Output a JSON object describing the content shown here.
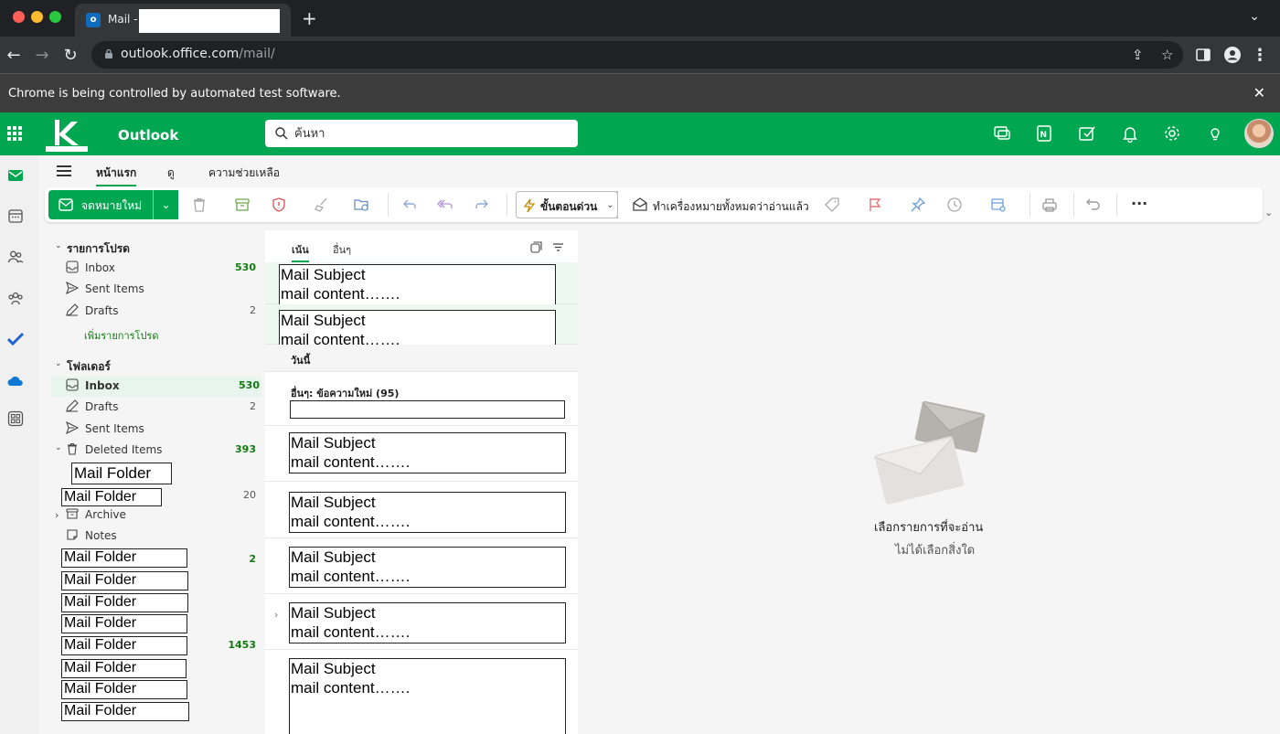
{
  "browser": {
    "tab_title": "Mail -",
    "new_tab": "+",
    "url_host": "outlook.office.com",
    "url_path": "/mail/",
    "automation_banner": "Chrome is being controlled by automated test software.",
    "close": "✕"
  },
  "header": {
    "app_title": "Outlook",
    "search_placeholder": "ค้นหา",
    "brand_color": "#00a650"
  },
  "ribbon": {
    "tabs": [
      "หน้าแรก",
      "ดู",
      "ความช่วยเหลือ"
    ],
    "new_mail_label": "จดหมายใหม่",
    "quick_steps_label": "ขั้นตอนด่วน",
    "mark_all_read_label": "ทำเครื่องหมายทั้งหมดว่าอ่านแล้ว",
    "more": "···"
  },
  "favorites": {
    "title": "รายการโปรด",
    "items": [
      {
        "label": "Inbox",
        "count": "530"
      },
      {
        "label": "Sent Items",
        "count": ""
      },
      {
        "label": "Drafts",
        "count": "2"
      }
    ],
    "add_favorite": "เพิ่มรายการโปรด"
  },
  "folders": {
    "title": "โฟลเดอร์",
    "items": [
      {
        "label": "Inbox",
        "count": "530"
      },
      {
        "label": "Drafts",
        "count": "2"
      },
      {
        "label": "Sent Items",
        "count": ""
      },
      {
        "label": "Deleted Items",
        "count": "393"
      },
      {
        "label": "Archive",
        "count": ""
      },
      {
        "label": "Notes",
        "count": ""
      }
    ],
    "masked_folder_label": "Mail Folder",
    "masked_counts": {
      "first": "20",
      "second": "2",
      "third": "1453"
    }
  },
  "message_list": {
    "tabs": [
      "เน้น",
      "อื่นๆ"
    ],
    "subject": "Mail Subject",
    "preview": "mail content…….",
    "day_header": "วันนี้",
    "other_summary": "อื่นๆ: ข้อความใหม่ (95)"
  },
  "reading_pane": {
    "title": "เลือกรายการที่จะอ่าน",
    "subtitle": "ไม่ได้เลือกสิ่งใด"
  }
}
